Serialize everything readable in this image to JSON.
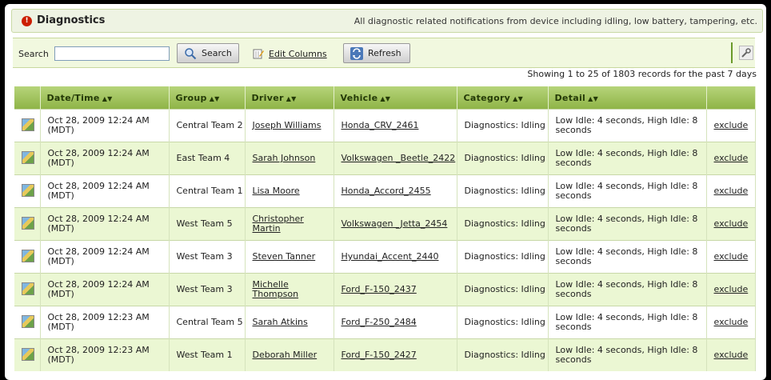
{
  "header": {
    "title": "Diagnostics",
    "description": "All diagnostic related notifications from device including idling, low battery, tampering, etc."
  },
  "toolbar": {
    "search_label": "Search",
    "search_value": "",
    "search_button": "Search",
    "edit_columns": "Edit Columns",
    "refresh_button": "Refresh"
  },
  "records_text": "Showing 1 to 25 of 1803 records for the past 7 days",
  "columns": [
    "Date/Time",
    "Group",
    "Driver",
    "Vehicle",
    "Category",
    "Detail"
  ],
  "rows": [
    {
      "datetime": "Oct 28, 2009 12:24 AM (MDT)",
      "group": "Central Team 2",
      "driver": "Joseph Williams",
      "vehicle": "Honda_CRV_2461",
      "category": "Diagnostics: Idling",
      "detail": "Low Idle: 4 seconds, High Idle: 8 seconds",
      "action": "exclude"
    },
    {
      "datetime": "Oct 28, 2009 12:24 AM (MDT)",
      "group": "East Team 4",
      "driver": "Sarah Johnson",
      "vehicle": "Volkswagen _Beetle_2422",
      "category": "Diagnostics: Idling",
      "detail": "Low Idle: 4 seconds, High Idle: 8 seconds",
      "action": "exclude"
    },
    {
      "datetime": "Oct 28, 2009 12:24 AM (MDT)",
      "group": "Central Team 1",
      "driver": "Lisa Moore",
      "vehicle": "Honda_Accord_2455",
      "category": "Diagnostics: Idling",
      "detail": "Low Idle: 4 seconds, High Idle: 8 seconds",
      "action": "exclude"
    },
    {
      "datetime": "Oct 28, 2009 12:24 AM (MDT)",
      "group": "West Team 5",
      "driver": "Christopher Martin",
      "vehicle": "Volkswagen _Jetta_2454",
      "category": "Diagnostics: Idling",
      "detail": "Low Idle: 4 seconds, High Idle: 8 seconds",
      "action": "exclude"
    },
    {
      "datetime": "Oct 28, 2009 12:24 AM (MDT)",
      "group": "West Team 3",
      "driver": "Steven Tanner",
      "vehicle": "Hyundai_Accent_2440",
      "category": "Diagnostics: Idling",
      "detail": "Low Idle: 4 seconds, High Idle: 8 seconds",
      "action": "exclude"
    },
    {
      "datetime": "Oct 28, 2009 12:24 AM (MDT)",
      "group": "West Team 3",
      "driver": "Michelle Thompson",
      "vehicle": "Ford_F-150_2437",
      "category": "Diagnostics: Idling",
      "detail": "Low Idle: 4 seconds, High Idle: 8 seconds",
      "action": "exclude"
    },
    {
      "datetime": "Oct 28, 2009 12:23 AM (MDT)",
      "group": "Central Team 5",
      "driver": "Sarah Atkins",
      "vehicle": "Ford_F-250_2484",
      "category": "Diagnostics: Idling",
      "detail": "Low Idle: 4 seconds, High Idle: 8 seconds",
      "action": "exclude"
    },
    {
      "datetime": "Oct 28, 2009 12:23 AM (MDT)",
      "group": "West Team 1",
      "driver": "Deborah Miller",
      "vehicle": "Ford_F-150_2427",
      "category": "Diagnostics: Idling",
      "detail": "Low Idle: 4 seconds, High Idle: 8 seconds",
      "action": "exclude"
    }
  ]
}
